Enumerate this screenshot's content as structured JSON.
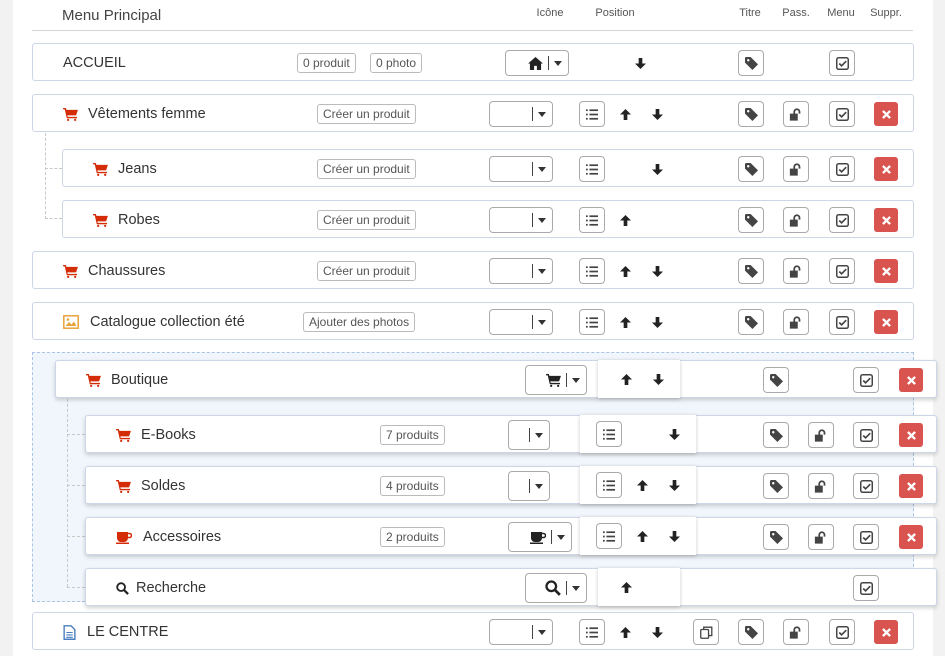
{
  "header": {
    "title": "Menu Principal",
    "col_icon": "Icône",
    "col_position": "Position",
    "col_title": "Titre",
    "col_pass": "Pass.",
    "col_menu": "Menu",
    "col_delete": "Suppr."
  },
  "rows": {
    "accueil": {
      "label": "ACCUEIL",
      "tag1": "0 produit",
      "tag2": "0 photo"
    },
    "vetements": {
      "label": "Vêtements femme",
      "tag": "Créer un produit"
    },
    "jeans": {
      "label": "Jeans",
      "tag": "Créer un produit"
    },
    "robes": {
      "label": "Robes",
      "tag": "Créer un produit"
    },
    "chaussures": {
      "label": "Chaussures",
      "tag": "Créer un produit"
    },
    "catalogue": {
      "label": "Catalogue collection été",
      "tag": "Ajouter des photos"
    },
    "boutique": {
      "label": "Boutique"
    },
    "ebooks": {
      "label": "E-Books",
      "tag": "7 produits"
    },
    "soldes": {
      "label": "Soldes",
      "tag": "4 produits"
    },
    "accessoires": {
      "label": "Accessoires",
      "tag": "2 produits"
    },
    "recherche": {
      "label": "Recherche"
    },
    "lecentre": {
      "label": "LE CENTRE"
    }
  },
  "icons": {
    "cart": "shopping-cart-icon",
    "home": "home-icon",
    "image": "picture-icon",
    "cup": "coffee-cup-icon",
    "search": "search-icon",
    "doc": "document-icon",
    "list": "list-icon",
    "tag": "tag-icon",
    "lock": "unlock-icon",
    "check": "check-square-icon",
    "del": "close-icon",
    "copy": "copy-icon"
  },
  "colors": {
    "accent": "#d42c07",
    "delete": "#d9534f",
    "border": "#cdd6e6",
    "image_icon": "#e8a33b",
    "doc_icon": "#4a7fc0"
  }
}
